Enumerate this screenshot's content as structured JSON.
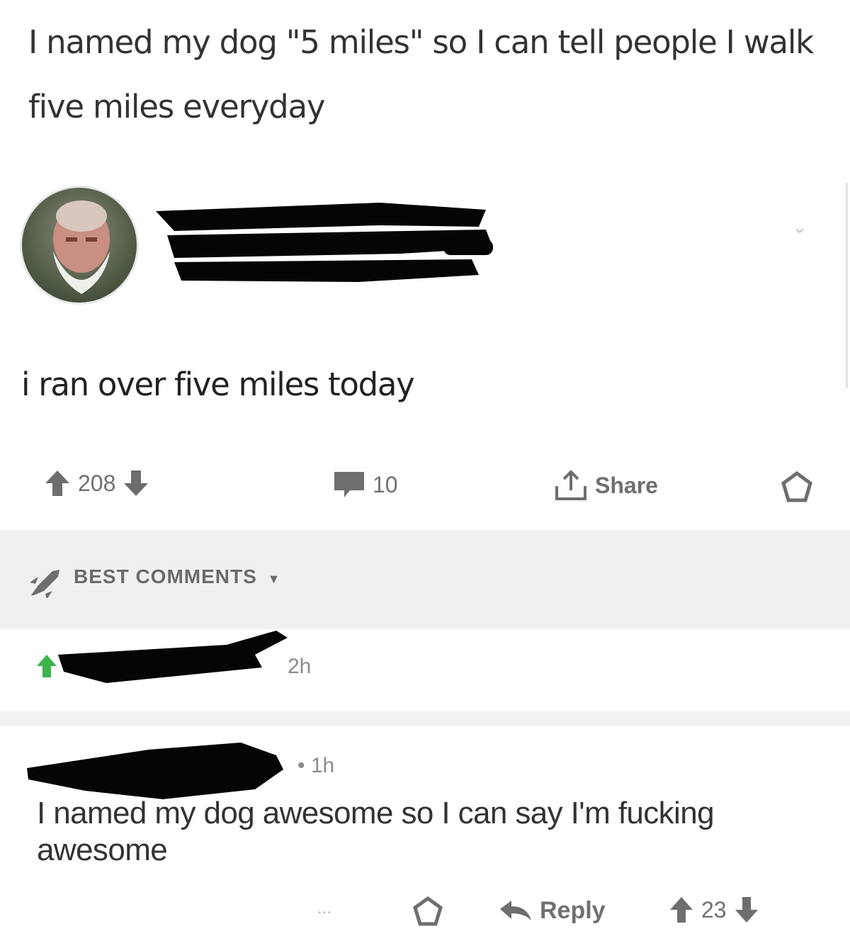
{
  "post": {
    "title": "I named my dog \"5 miles\" so I can tell people I walk five miles everyday",
    "body": "i ran over five miles today",
    "upvotes": "208",
    "comments": "10",
    "share_label": "Share"
  },
  "comments_section": {
    "sort_label": "BEST COMMENTS"
  },
  "comments": [
    {
      "time": "2h"
    },
    {
      "time": "1h",
      "separator": "•",
      "body": "I named my dog awesome so I can say I'm fucking awesome",
      "reply_label": "Reply",
      "more_label": "...",
      "score": "23"
    }
  ],
  "colors": {
    "background": "#ffffff",
    "text": "#333333",
    "muted": "#707070",
    "section_bg": "#f0f0f2",
    "upvote_green": "#3cb44b"
  }
}
